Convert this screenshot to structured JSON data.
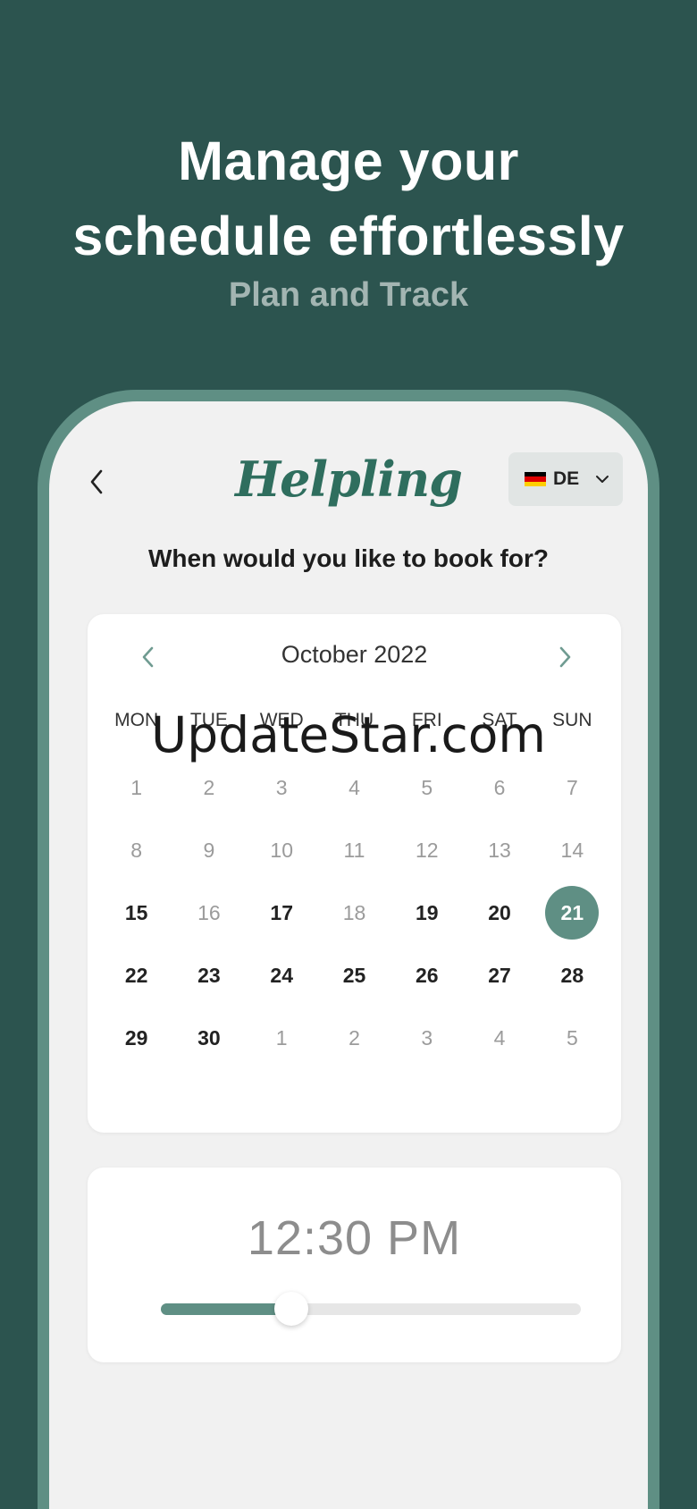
{
  "hero": {
    "title_line1": "Manage your",
    "title_line2": "schedule effortlessly",
    "subtitle": "Plan and Track"
  },
  "header": {
    "logo": "Helpling",
    "language": "DE"
  },
  "booking": {
    "question": "When would you like to book for?"
  },
  "calendar": {
    "month": "October 2022",
    "weekdays": [
      "MON",
      "TUE",
      "WED",
      "THU",
      "FRI",
      "SAT",
      "SUN"
    ],
    "days": [
      {
        "d": "1",
        "s": "muted"
      },
      {
        "d": "2",
        "s": "muted"
      },
      {
        "d": "3",
        "s": "muted"
      },
      {
        "d": "4",
        "s": "muted"
      },
      {
        "d": "5",
        "s": "muted"
      },
      {
        "d": "6",
        "s": "muted"
      },
      {
        "d": "7",
        "s": "muted"
      },
      {
        "d": "8",
        "s": "muted"
      },
      {
        "d": "9",
        "s": "muted"
      },
      {
        "d": "10",
        "s": "muted"
      },
      {
        "d": "11",
        "s": "muted"
      },
      {
        "d": "12",
        "s": "muted"
      },
      {
        "d": "13",
        "s": "muted"
      },
      {
        "d": "14",
        "s": "muted"
      },
      {
        "d": "15",
        "s": "bold"
      },
      {
        "d": "16",
        "s": "muted"
      },
      {
        "d": "17",
        "s": "bold"
      },
      {
        "d": "18",
        "s": "muted"
      },
      {
        "d": "19",
        "s": "bold"
      },
      {
        "d": "20",
        "s": "bold"
      },
      {
        "d": "21",
        "s": "selected"
      },
      {
        "d": "22",
        "s": "bold"
      },
      {
        "d": "23",
        "s": "bold"
      },
      {
        "d": "24",
        "s": "bold"
      },
      {
        "d": "25",
        "s": "bold"
      },
      {
        "d": "26",
        "s": "bold"
      },
      {
        "d": "27",
        "s": "bold"
      },
      {
        "d": "28",
        "s": "bold"
      },
      {
        "d": "29",
        "s": "bold"
      },
      {
        "d": "30",
        "s": "bold"
      },
      {
        "d": "1",
        "s": "muted"
      },
      {
        "d": "2",
        "s": "muted"
      },
      {
        "d": "3",
        "s": "muted"
      },
      {
        "d": "4",
        "s": "muted"
      },
      {
        "d": "5",
        "s": "muted"
      }
    ]
  },
  "time": {
    "value": "12:30 PM",
    "slider_fraction": 0.31
  },
  "watermark": "UpdateStar.com",
  "colors": {
    "background": "#2c544f",
    "accent": "#5f8f84",
    "logo": "#2f6e5e"
  }
}
